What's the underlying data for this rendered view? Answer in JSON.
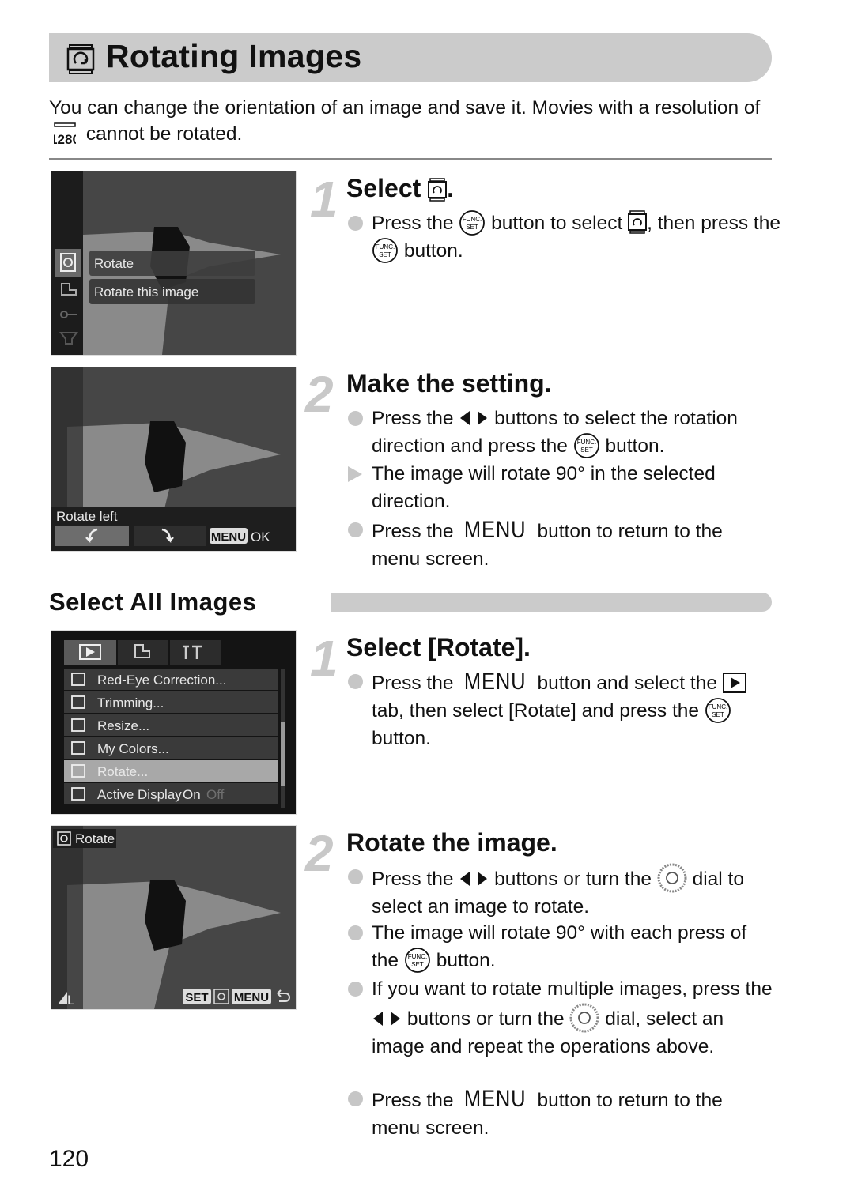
{
  "page": {
    "title": "Rotating Images",
    "title_icon": "rotate-icon",
    "intro_part1": "You can change the orientation of an image and save it. Movies with a resolution of",
    "intro_icon": "movie-1280-icon",
    "intro_part2": "cannot be rotated.",
    "page_number": "120"
  },
  "section1": {
    "steps": [
      {
        "number": "1",
        "title": "Select",
        "title_icon": "rotate-icon",
        "title_suffix": ".",
        "bullets": [
          {
            "type": "dot",
            "parts": [
              "Press the",
              "func-set-button-icon",
              "button to select",
              "rotate-icon",
              ", then press the",
              "func-set-button-icon",
              "button."
            ]
          }
        ]
      },
      {
        "number": "2",
        "title": "Make the setting.",
        "bullets": [
          {
            "type": "dot",
            "text_a": "Press the",
            "text_b": "buttons to select the rotation direction and press the",
            "text_c": "button."
          },
          {
            "type": "result",
            "text": "The image will rotate 90° in the selected direction."
          },
          {
            "type": "dot",
            "text_a": "Press the",
            "menu": "MENU",
            "text_b": "button to return to the menu screen."
          }
        ]
      }
    ],
    "screen1": {
      "menu_items": [
        "Rotate",
        "Rotate this image"
      ],
      "side_icons": [
        "rotate-icon",
        "print-icon",
        "protect-key-icon",
        "filter-icon"
      ]
    },
    "screen2": {
      "label": "Rotate left",
      "buttons": [
        "rotate-left-icon",
        "rotate-right-icon"
      ],
      "menu_key": "MENU",
      "ok_label": "OK"
    }
  },
  "section2": {
    "heading": "Select All Images",
    "steps": [
      {
        "number": "1",
        "title": "Select [Rotate].",
        "bullets": [
          {
            "type": "dot",
            "text_a": "Press the",
            "menu": "MENU",
            "text_b": "button and select the",
            "text_c": "tab, then select [Rotate] and press the",
            "text_d": "button."
          }
        ]
      },
      {
        "number": "2",
        "title": "Rotate the image.",
        "bullets": [
          {
            "type": "dot",
            "text_a": "Press the",
            "text_b": "buttons or turn the",
            "text_c": "dial to select an image to rotate."
          },
          {
            "type": "dot",
            "text_a": "The image will rotate 90° with each press of the",
            "text_b": "button."
          },
          {
            "type": "dot",
            "text_a": "If you want to rotate multiple images, press the",
            "text_b": "buttons or turn the",
            "text_c": "dial, select an image and repeat the operations above."
          },
          {
            "type": "dot",
            "text_a": "Press the",
            "menu": "MENU",
            "text_b": "button to return to the menu screen."
          }
        ]
      }
    ],
    "screen3": {
      "tabs": [
        "playback-tab-icon",
        "print-tab-icon",
        "settings-tab-icon"
      ],
      "menu_items": [
        {
          "icon": "red-eye-icon",
          "label": "Red-Eye Correction..."
        },
        {
          "icon": "trimming-icon",
          "label": "Trimming..."
        },
        {
          "icon": "resize-icon",
          "label": "Resize..."
        },
        {
          "icon": "my-colors-icon",
          "label": "My Colors..."
        },
        {
          "icon": "rotate-icon",
          "label": "Rotate...",
          "selected": true
        },
        {
          "icon": "active-display-icon",
          "label": "Active Display",
          "value_on": "On",
          "value_off": "Off"
        }
      ]
    },
    "screen4": {
      "label": "Rotate",
      "size_label": "L",
      "set_key": "SET",
      "menu_key": "MENU"
    }
  }
}
